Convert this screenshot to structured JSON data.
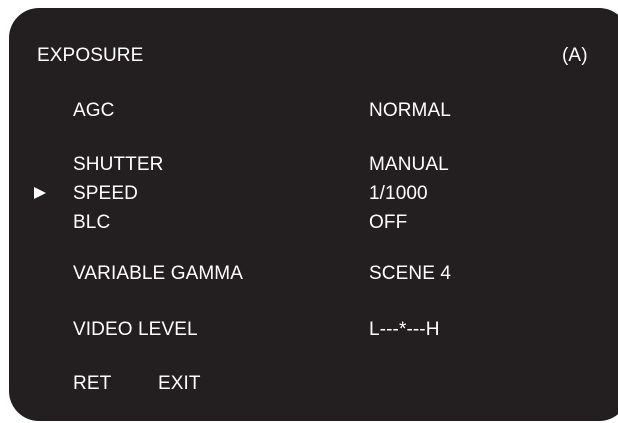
{
  "menu": {
    "title": "EXPOSURE",
    "mode_indicator": "(A)",
    "cursor_icon": "right-triangle-icon",
    "colors": {
      "background": "#231f20",
      "text": "#ffffff"
    },
    "items": [
      {
        "label": "AGC",
        "value": "NORMAL"
      },
      {
        "label": "SHUTTER",
        "value": "MANUAL"
      },
      {
        "label": "SPEED",
        "value": "1/1000",
        "selected": true
      },
      {
        "label": "BLC",
        "value": "OFF"
      },
      {
        "label": "VARIABLE GAMMA",
        "value": "SCENE 4"
      },
      {
        "label": "VIDEO LEVEL",
        "value": "L---*---H"
      }
    ],
    "footer": {
      "ret_label": "RET",
      "exit_label": "EXIT"
    }
  }
}
